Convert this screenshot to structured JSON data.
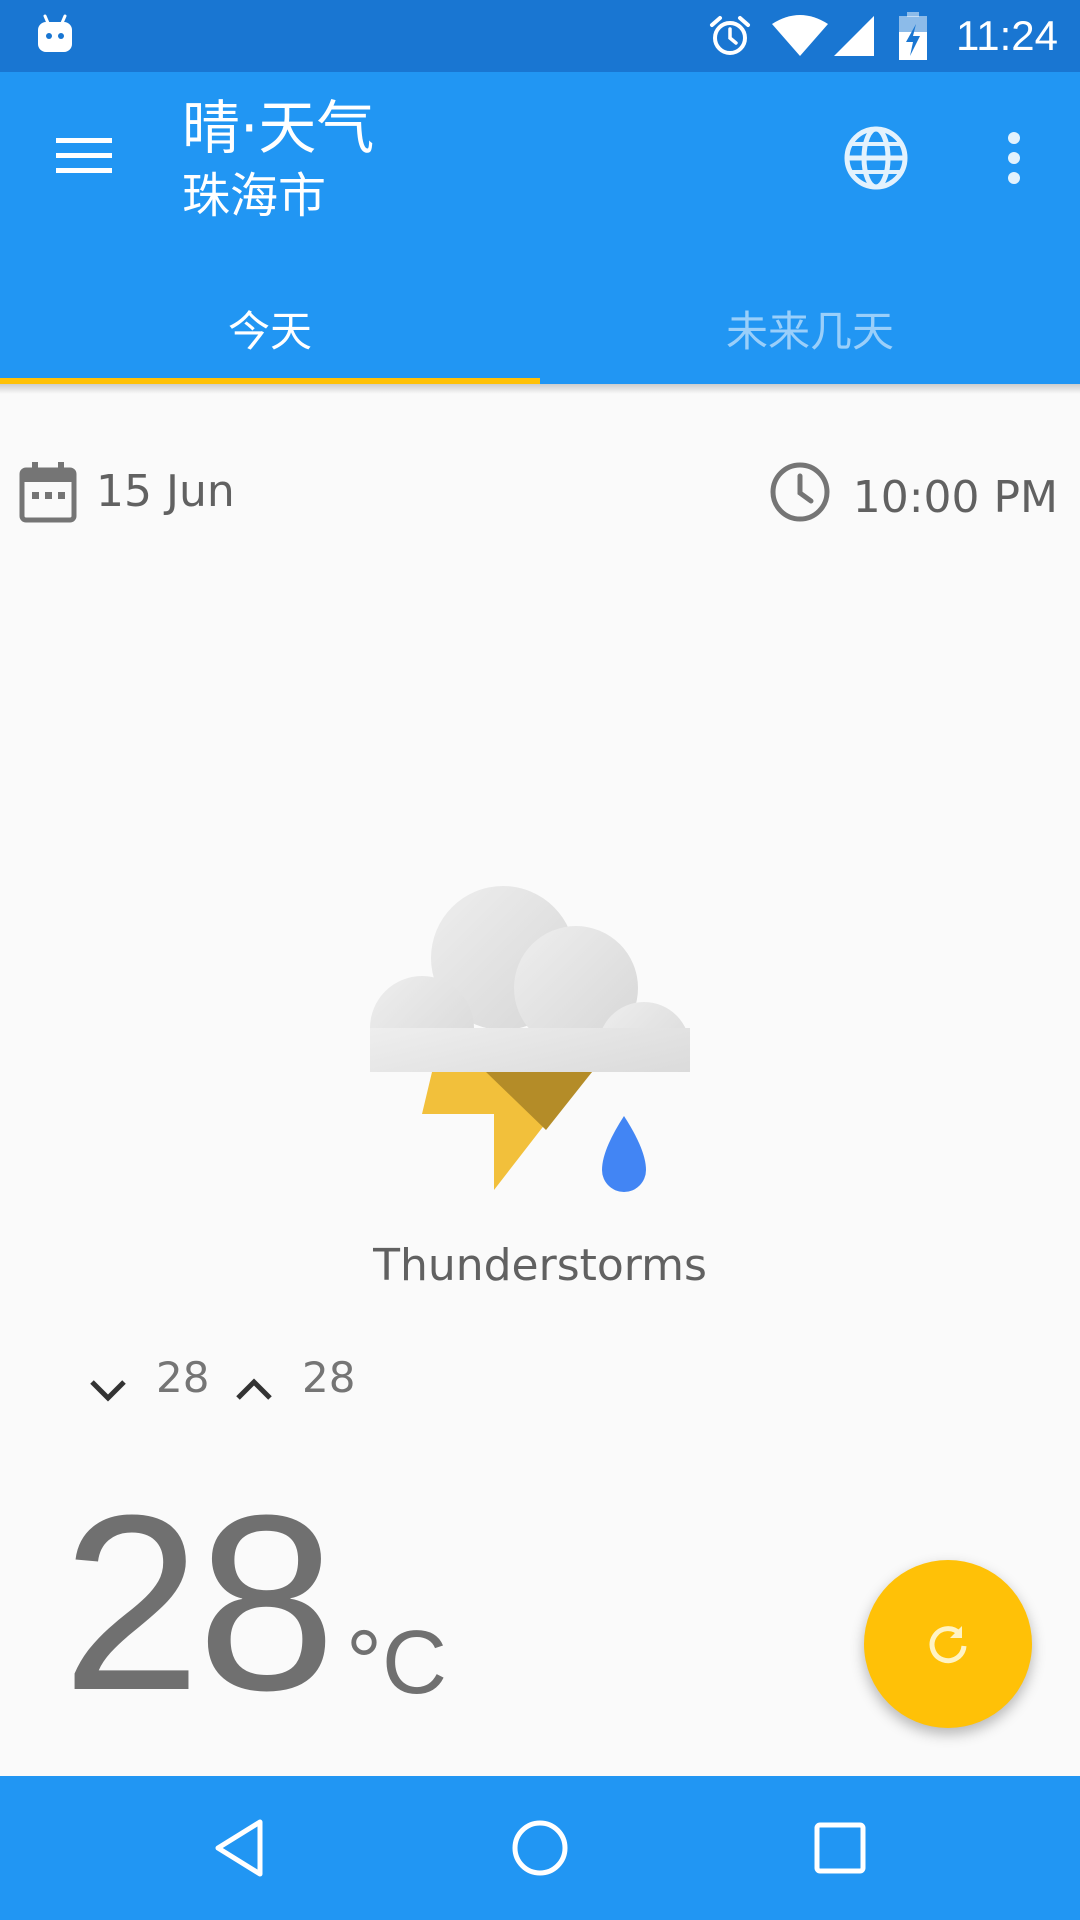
{
  "status_bar": {
    "time": "11:24",
    "icons": [
      "android-robot-icon",
      "alarm-icon",
      "wifi-icon",
      "cell-signal-icon",
      "battery-charging-icon"
    ]
  },
  "app_bar": {
    "title": "晴·天气",
    "subtitle": "珠海市",
    "menu_icon": "hamburger-menu-icon",
    "actions": [
      "globe-icon",
      "more-vert-icon"
    ],
    "colors": {
      "primary": "#2196F3",
      "primary_dark": "#1976D2",
      "accent": "#FFC107"
    }
  },
  "tabs": [
    {
      "label": "今天",
      "selected": true
    },
    {
      "label": "未来几天",
      "selected": false
    }
  ],
  "today": {
    "date": "15 Jun",
    "time": "10:00 PM",
    "condition": "Thunderstorms",
    "condition_icon": "thunderstorm-icon",
    "min_temp": "28",
    "max_temp": "28",
    "current_temp": "28",
    "unit": "°C"
  },
  "fab": {
    "icon": "refresh-icon"
  },
  "nav_bar": {
    "buttons": [
      "back-icon",
      "home-icon",
      "recents-icon"
    ]
  }
}
